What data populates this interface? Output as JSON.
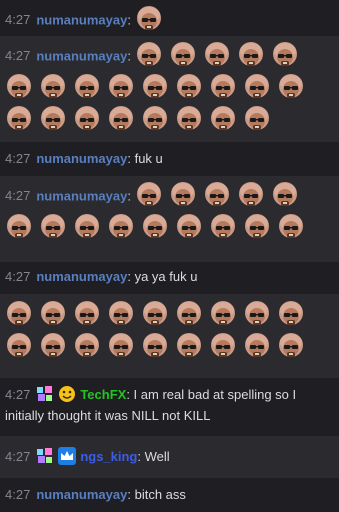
{
  "messages": [
    {
      "time": "4:27",
      "user": "numanumayay",
      "text": ""
    },
    {
      "time": "4:27",
      "user": "numanumayay",
      "text": ""
    },
    {
      "time": "4:27",
      "user": "numanumayay",
      "text": "fuk u"
    },
    {
      "time": "4:27",
      "user": "numanumayay",
      "text": ""
    },
    {
      "time": "4:27",
      "user": "numanumayay",
      "text": "ya ya fuk u"
    },
    {
      "time": "",
      "user": "",
      "text": ""
    },
    {
      "time": "4:27",
      "user": "TechFX",
      "text": "I am real bad at spelling so I initially thought it was NILL not KILL"
    },
    {
      "time": "4:27",
      "user": "ngs_king",
      "text": "Well"
    },
    {
      "time": "4:27",
      "user": "numanumayay",
      "text": "bitch ass"
    }
  ],
  "colors": {
    "numanumayay": "#5a7fbf",
    "TechFX": "#22c322",
    "ngs_king": "#3b5ee8",
    "timestamp": "#85858d",
    "background": "#18181b"
  },
  "emote": "sunglasses-face-emote"
}
